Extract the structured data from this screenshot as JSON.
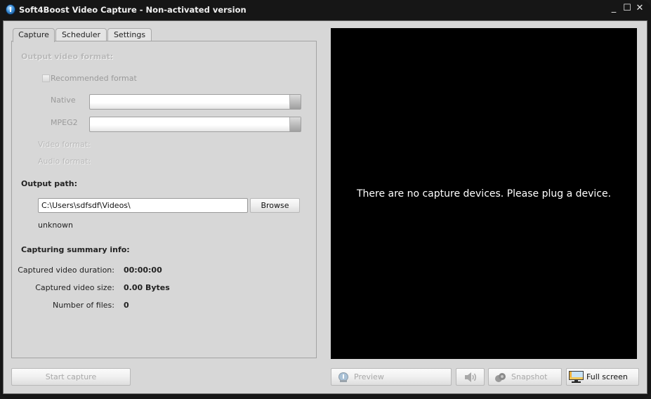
{
  "window": {
    "title": "Soft4Boost Video Capture - Non-activated version",
    "controls": {
      "minimize": "_",
      "maximize": "☐",
      "close": "✕"
    }
  },
  "tabs": [
    {
      "label": "Capture",
      "active": true
    },
    {
      "label": "Scheduler",
      "active": false
    },
    {
      "label": "Settings",
      "active": false
    }
  ],
  "capture": {
    "output_video_format_heading": "Output video format:",
    "recommended_format_label": "Recommended format",
    "recommended_format_checked": false,
    "native_label": "Native",
    "native_value": "",
    "mpeg2_label": "MPEG2",
    "mpeg2_value": "",
    "video_format_label": "Video format:",
    "audio_format_label": "Audio format:",
    "output_path_heading": "Output path:",
    "output_path_value": "C:\\Users\\sdfsdf\\Videos\\",
    "browse_label": "Browse",
    "free_space_text": "unknown",
    "summary_heading": "Capturing summary info:",
    "summary": [
      {
        "label": "Captured video duration:",
        "value": "00:00:00"
      },
      {
        "label": "Captured video size:",
        "value": "0.00 Bytes"
      },
      {
        "label": "Number of files:",
        "value": "0"
      }
    ],
    "start_capture_label": "Start capture"
  },
  "video": {
    "message": "There are no capture devices. Please plug a device."
  },
  "bottom_bar": {
    "preview_label": "Preview",
    "snapshot_label": "Snapshot",
    "fullscreen_label": "Full screen"
  }
}
